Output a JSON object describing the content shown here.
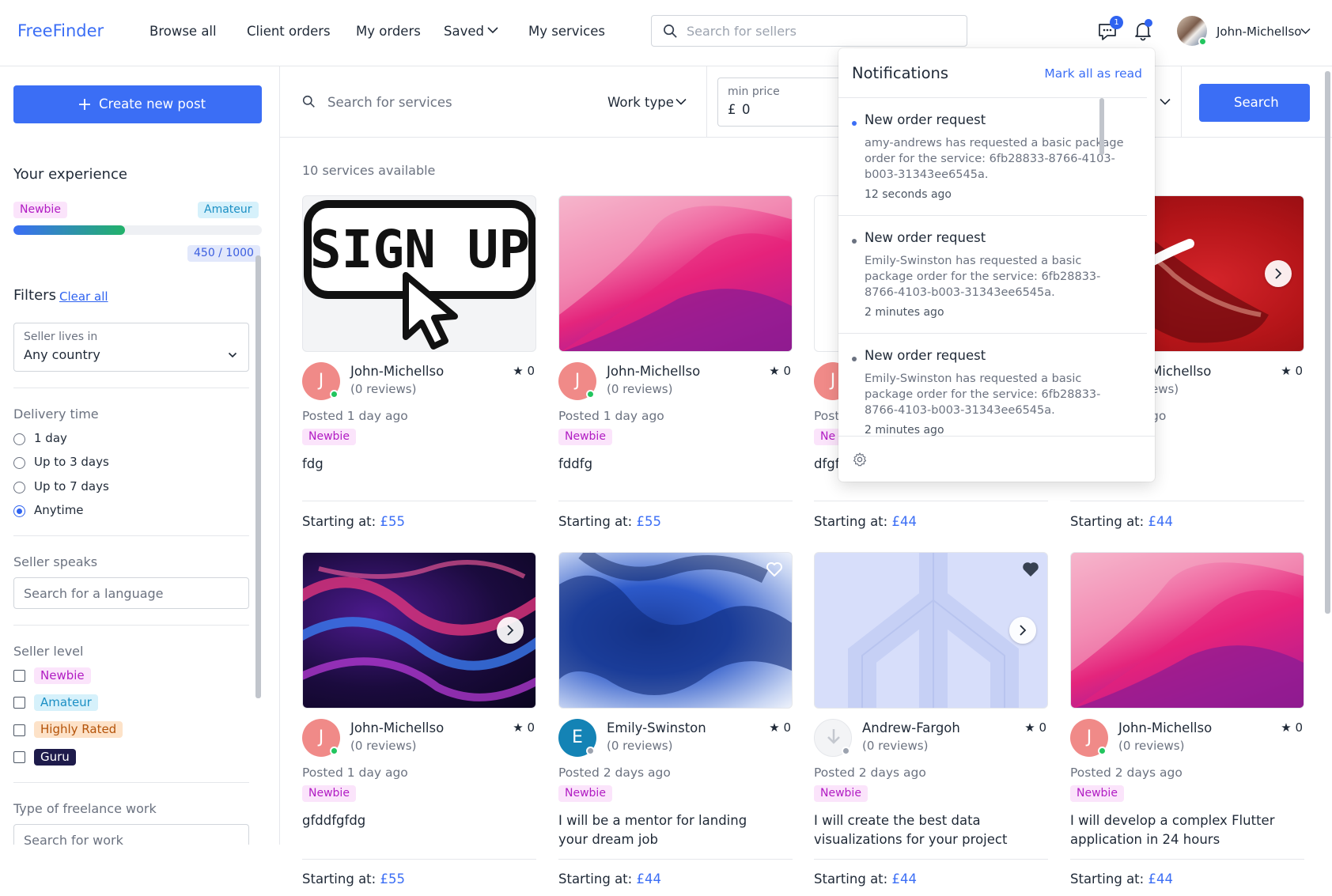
{
  "header": {
    "logo": "FreeFinder",
    "nav": [
      "Browse all",
      "Client orders",
      "My orders",
      "Saved",
      "My services"
    ],
    "seller_search_placeholder": "Search for sellers",
    "messages_badge": "1",
    "username": "John-Michellso"
  },
  "sidebar": {
    "create_label": "Create new post",
    "experience_title": "Your experience",
    "level_current": "Newbie",
    "level_next": "Amateur",
    "progress_fraction": 0.45,
    "score": "450 / 1000",
    "filters_title": "Filters",
    "clear_all": "Clear all",
    "country_label": "Seller lives in",
    "country_value": "Any country",
    "delivery_title": "Delivery time",
    "delivery_options": [
      "1 day",
      "Up to 3 days",
      "Up to 7 days",
      "Anytime"
    ],
    "delivery_selected": "Anytime",
    "speaks_title": "Seller speaks",
    "language_placeholder": "Search for a language",
    "level_title": "Seller level",
    "levels": [
      "Newbie",
      "Amateur",
      "Highly Rated",
      "Guru"
    ],
    "work_type_title": "Type of freelance work",
    "work_placeholder": "Search for work"
  },
  "filterbar": {
    "service_search_placeholder": "Search for services",
    "work_type": "Work type",
    "min_price_label": "min price",
    "min_price_currency": "£",
    "min_price_value": "0",
    "search_button": "Search"
  },
  "main": {
    "count_text": "10 services available",
    "cards": [
      {
        "user": "John-Michellso",
        "initial": "J",
        "reviews": "(0 reviews)",
        "rating": "★ 0",
        "posted": "Posted 1 day ago",
        "level": "Newbie",
        "title": "fdg",
        "price_label": "Starting at:",
        "price": "£55",
        "image": "sign-up-pixel"
      },
      {
        "user": "John-Michellso",
        "initial": "J",
        "reviews": "(0 reviews)",
        "rating": "★ 0",
        "posted": "Posted 1 day ago",
        "level": "Newbie",
        "title": "fddfg",
        "price_label": "Starting at:",
        "price": "£55",
        "image": "pink-waves"
      },
      {
        "user": "J",
        "initial": "J",
        "reviews": "",
        "rating": "",
        "posted": "Post",
        "level": "Ne",
        "title": "dfgf",
        "price_label": "Starting at:",
        "price": "£44",
        "image": "white"
      },
      {
        "user": "Michellso",
        "initial": "",
        "reviews": "ews)",
        "rating": "★ 0",
        "posted": "go",
        "level": "",
        "title": "",
        "price_label": "Starting at:",
        "price": "£44",
        "image": "red-sneaker"
      },
      {
        "user": "John-Michellso",
        "initial": "J",
        "reviews": "(0 reviews)",
        "rating": "★ 0",
        "posted": "Posted 1 day ago",
        "level": "Newbie",
        "title": "gfddfgfdg",
        "price_label": "Starting at:",
        "price": "£55",
        "image": "neon-swirl"
      },
      {
        "user": "Emily-Swinston",
        "initial": "E",
        "reviews": "(0 reviews)",
        "rating": "★ 0",
        "posted": "Posted 2 days ago",
        "level": "Newbie",
        "title": "I will be a mentor for landing your dream job",
        "price_label": "Starting at:",
        "price": "£44",
        "image": "blue-ink"
      },
      {
        "user": "Andrew-Fargoh",
        "initial": "",
        "reviews": "(0 reviews)",
        "rating": "★ 0",
        "posted": "Posted 2 days ago",
        "level": "Newbie",
        "title": "I will create the best data visualizations for your project",
        "price_label": "Starting at:",
        "price": "£44",
        "image": "placeholder-blue"
      },
      {
        "user": "John-Michellso",
        "initial": "J",
        "reviews": "(0 reviews)",
        "rating": "★ 0",
        "posted": "Posted 2 days ago",
        "level": "Newbie",
        "title": "I will develop a complex Flutter application in 24 hours",
        "price_label": "Starting at:",
        "price": "£44",
        "image": "pink-waves"
      }
    ]
  },
  "notifications": {
    "title": "Notifications",
    "mark_all": "Mark all as read",
    "items": [
      {
        "title": "New order request",
        "body": "amy-andrews has requested a basic package order for the service: 6fb28833-8766-4103-b003-31343ee6545a.",
        "time": "12 seconds ago",
        "unread": true
      },
      {
        "title": "New order request",
        "body": "Emily-Swinston has requested a basic package order for the service: 6fb28833-8766-4103-b003-31343ee6545a.",
        "time": "2 minutes ago",
        "unread": false
      },
      {
        "title": "New order request",
        "body": "Emily-Swinston has requested a basic package order for the service: 6fb28833-8766-4103-b003-31343ee6545a.",
        "time": "2 minutes ago",
        "unread": false
      }
    ]
  },
  "colors": {
    "accent": "#3b6ef5",
    "online": "#22c55e",
    "avatar_pink": "#f08a88",
    "avatar_teal": "#1483b5"
  }
}
